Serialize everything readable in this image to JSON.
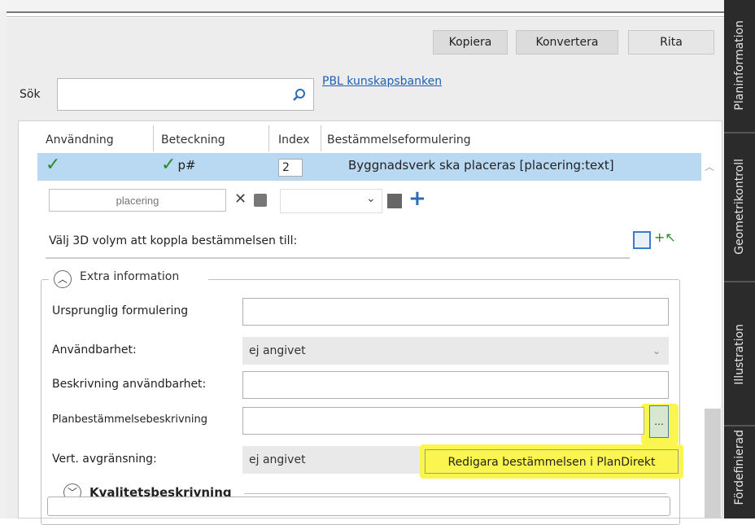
{
  "toolbar": {
    "kopiera": "Kopiera",
    "konvertera": "Konvertera",
    "rita": "Rita"
  },
  "search": {
    "label": "Sök",
    "value": "",
    "placeholder": "",
    "link": "PBL kunskapsbanken"
  },
  "grid": {
    "columns": [
      "Användning",
      "Beteckning",
      "Index",
      "Bestämmelseformulering"
    ],
    "row": {
      "anvandning_icon": "✓",
      "beteckning_icon": "✓",
      "beteckning": "p#",
      "index": "2",
      "bestammelse": "Byggnadsverk ska placeras [placering:text]"
    }
  },
  "edit": {
    "placering_placeholder": "placering",
    "select_value": ""
  },
  "volym": {
    "label": "Välj 3D volym att koppla bestämmelsen till:"
  },
  "extra": {
    "title": "Extra information",
    "fields": {
      "ursprunglig": {
        "label": "Ursprunglig formulering",
        "value": ""
      },
      "anvandbarhet": {
        "label": "Användbarhet:",
        "value": "ej angivet"
      },
      "beskrivning": {
        "label": "Beskrivning användbarhet:",
        "value": ""
      },
      "planbest": {
        "label": "Planbestämmelsebeskrivning",
        "value": "",
        "button": "..."
      },
      "vert": {
        "label": "Vert. avgränsning:",
        "value": "ej angivet"
      }
    },
    "tooltip": "Redigara bestämmelsen i PlanDirekt"
  },
  "kvalitet": {
    "title": "Kvalitetsbeskrivning"
  },
  "sidebar": {
    "tabs": [
      "Planinformation",
      "Geometrikontroll",
      "Illustration",
      "Fördefinierad"
    ]
  },
  "colors": {
    "selected_row": "#b9d9f3",
    "highlight": "#fbf64f",
    "link": "#1f5fb3",
    "check": "#2a8a2a"
  }
}
